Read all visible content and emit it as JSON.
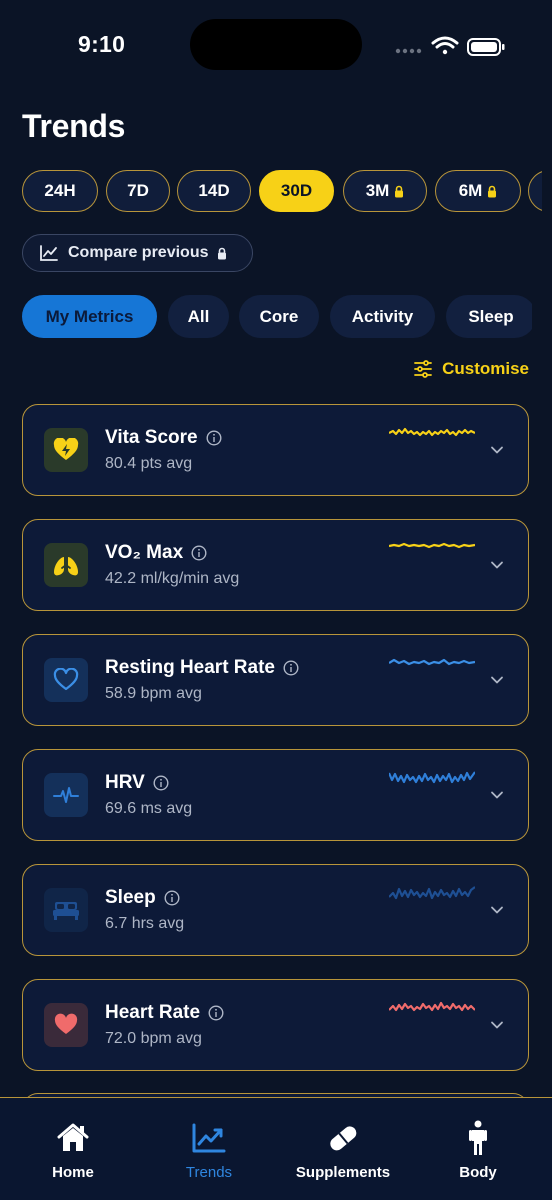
{
  "status_bar": {
    "time": "9:10"
  },
  "page": {
    "title": "Trends"
  },
  "time_ranges": [
    {
      "label": "24H",
      "active": false,
      "locked": false
    },
    {
      "label": "7D",
      "active": false,
      "locked": false
    },
    {
      "label": "14D",
      "active": false,
      "locked": false
    },
    {
      "label": "30D",
      "active": true,
      "locked": false
    },
    {
      "label": "3M",
      "active": false,
      "locked": true
    },
    {
      "label": "6M",
      "active": false,
      "locked": true
    }
  ],
  "compare": {
    "label": "Compare previous",
    "locked": true
  },
  "filters": [
    {
      "label": "My Metrics",
      "active": true
    },
    {
      "label": "All",
      "active": false
    },
    {
      "label": "Core",
      "active": false
    },
    {
      "label": "Activity",
      "active": false
    },
    {
      "label": "Sleep",
      "active": false
    }
  ],
  "customise": {
    "label": "Customise"
  },
  "metrics": [
    {
      "name": "Vita Score",
      "avg": "80.4 pts avg",
      "icon": "heart-bolt-icon",
      "color": "#f7d117"
    },
    {
      "name": "VO₂ Max",
      "avg": "42.2 ml/kg/min avg",
      "icon": "lungs-icon",
      "color": "#f7d117"
    },
    {
      "name": "Resting Heart Rate",
      "avg": "58.9 bpm avg",
      "icon": "heart-outline-icon",
      "color": "#3b8fe6"
    },
    {
      "name": "HRV",
      "avg": "69.6 ms avg",
      "icon": "pulse-icon",
      "color": "#2f7fd9"
    },
    {
      "name": "Sleep",
      "avg": "6.7 hrs avg",
      "icon": "bed-icon",
      "color": "#1e4f93"
    },
    {
      "name": "Heart Rate",
      "avg": "72.0 bpm avg",
      "icon": "heart-filled-icon",
      "color": "#f06b6b"
    }
  ],
  "tabs": [
    {
      "label": "Home",
      "icon": "home-icon",
      "active": false
    },
    {
      "label": "Trends",
      "icon": "trends-icon",
      "active": true
    },
    {
      "label": "Supplements",
      "icon": "pill-icon",
      "active": false
    },
    {
      "label": "Body",
      "icon": "body-icon",
      "active": false
    }
  ],
  "colors": {
    "accent": "#f7d117",
    "active_tab": "#2f86e0",
    "filter_active": "#1676d6",
    "card_border": "#b8953a",
    "background": "#0b1426"
  }
}
